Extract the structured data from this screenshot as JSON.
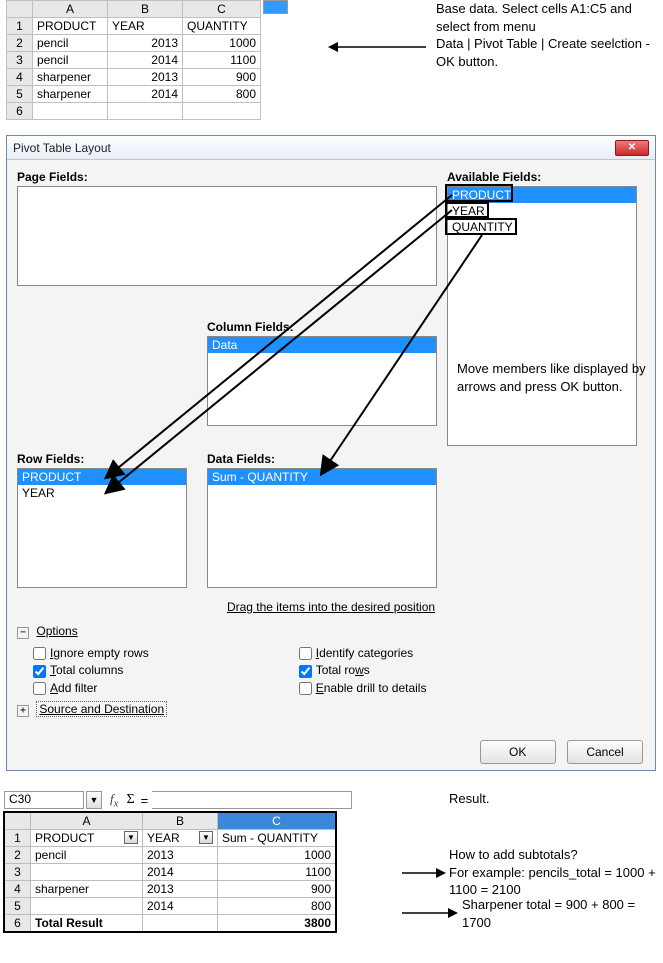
{
  "top_sheet": {
    "columns": [
      "A",
      "B",
      "C"
    ],
    "rows": [
      {
        "n": "1",
        "a": "PRODUCT",
        "b": "YEAR",
        "c": "QUANTITY"
      },
      {
        "n": "2",
        "a": "pencil",
        "b": "2013",
        "c": "1000"
      },
      {
        "n": "3",
        "a": "pencil",
        "b": "2014",
        "c": "1100"
      },
      {
        "n": "4",
        "a": "sharpener",
        "b": "2013",
        "c": "900"
      },
      {
        "n": "5",
        "a": "sharpener",
        "b": "2014",
        "c": "800"
      },
      {
        "n": "6",
        "a": "",
        "b": "",
        "c": ""
      }
    ]
  },
  "captions": {
    "top": "Base data. Select cells A1:C5 and select from menu\nData | Pivot Table | Create seelction -  OK button.",
    "mid": "Move members like displayed by arrows and press OK button.",
    "result_title": "Result.",
    "howto": "How to add subtotals?\nFor example: pencils_total = 1000 + 1100 = 2100",
    "sharp": "Sharpener total = 900 + 800 = 1700"
  },
  "dialog": {
    "title": "Pivot Table Layout",
    "labels": {
      "page": "Page Fields:",
      "available": "Available Fields:",
      "column": "Column Fields:",
      "row": "Row Fields:",
      "data": "Data Fields:",
      "drag": "Drag the items into the desired position"
    },
    "available_fields": [
      "PRODUCT",
      "YEAR",
      "QUANTITY"
    ],
    "column_fields": [
      "Data"
    ],
    "row_fields": [
      "PRODUCT",
      "YEAR"
    ],
    "data_fields": [
      "Sum - QUANTITY"
    ],
    "options": {
      "section": "Options",
      "ignore_empty": "Ignore empty rows",
      "total_columns": "Total columns",
      "add_filter": "Add filter",
      "identify": "Identify categories",
      "total_rows": "Total rows",
      "drill": "Enable drill to details",
      "srcdest": "Source and Destination"
    },
    "buttons": {
      "ok": "OK",
      "cancel": "Cancel"
    }
  },
  "result_sheet": {
    "cell_ref": "C30",
    "columns": [
      "A",
      "B",
      "C"
    ],
    "rows": [
      {
        "n": "1",
        "a": "PRODUCT",
        "b": "YEAR",
        "c": "Sum - QUANTITY"
      },
      {
        "n": "2",
        "a": "pencil",
        "b": "2013",
        "c": "1000"
      },
      {
        "n": "3",
        "a": "",
        "b": "2014",
        "c": "1100"
      },
      {
        "n": "4",
        "a": "sharpener",
        "b": "2013",
        "c": "900"
      },
      {
        "n": "5",
        "a": "",
        "b": "2014",
        "c": "800"
      },
      {
        "n": "6",
        "a": "Total Result",
        "b": "",
        "c": "3800"
      }
    ]
  }
}
